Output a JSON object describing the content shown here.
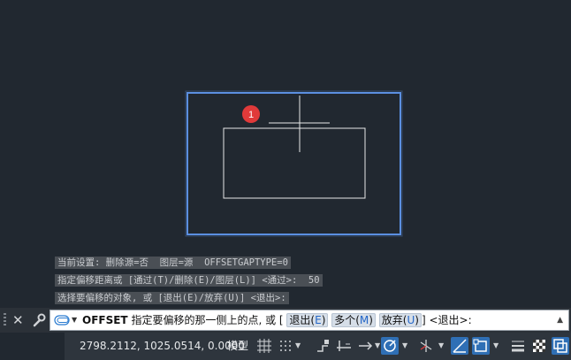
{
  "history": [
    "当前设置: 删除源=否  图层=源  OFFSETGAPTYPE=0",
    "指定偏移距离或 [通过(T)/删除(E)/图层(L)] <通过>:  50",
    "选择要偏移的对象, 或 [退出(E)/放弃(U)] <退出>:"
  ],
  "marker": {
    "label": "1",
    "color": "#e03a3a"
  },
  "command": {
    "name": "OFFSET",
    "prompt": "指定要偏移的那一侧上的点, 或 [",
    "options": [
      {
        "label": "退出(",
        "key": "E",
        "close": ")"
      },
      {
        "label": "多个(",
        "key": "M",
        "close": ")"
      },
      {
        "label": "放弃(",
        "key": "U",
        "close": ")"
      }
    ],
    "bracket_close": "]",
    "default": "<退出>:"
  },
  "status": {
    "coordinates": "2798.2112, 1025.0514, 0.0000",
    "model_tab": "模型"
  },
  "colors": {
    "selection": "#5b8fe0",
    "lines": "#e8e8e8",
    "active": "#2f6fb5"
  }
}
